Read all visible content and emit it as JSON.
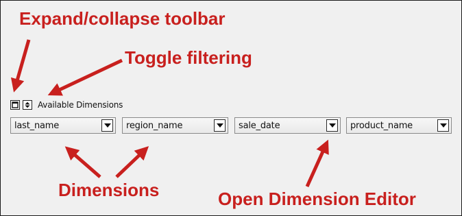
{
  "callouts": {
    "expand_collapse": "Expand/collapse toolbar",
    "toggle_filtering": "Toggle filtering",
    "dimensions": "Dimensions",
    "open_editor": "Open Dimension Editor"
  },
  "toolbar": {
    "available_label": "Available Dimensions",
    "buttons": [
      {
        "name": "expand-collapse",
        "icon": "window-square-icon"
      },
      {
        "name": "toggle-filtering",
        "icon": "up-down-arrows-icon"
      }
    ]
  },
  "dimensions": [
    {
      "label": "last_name"
    },
    {
      "label": "region_name"
    },
    {
      "label": "sale_date"
    },
    {
      "label": "product_name"
    }
  ],
  "colors": {
    "callout": "#c8201e",
    "panel_bg": "#f0f0f0"
  }
}
